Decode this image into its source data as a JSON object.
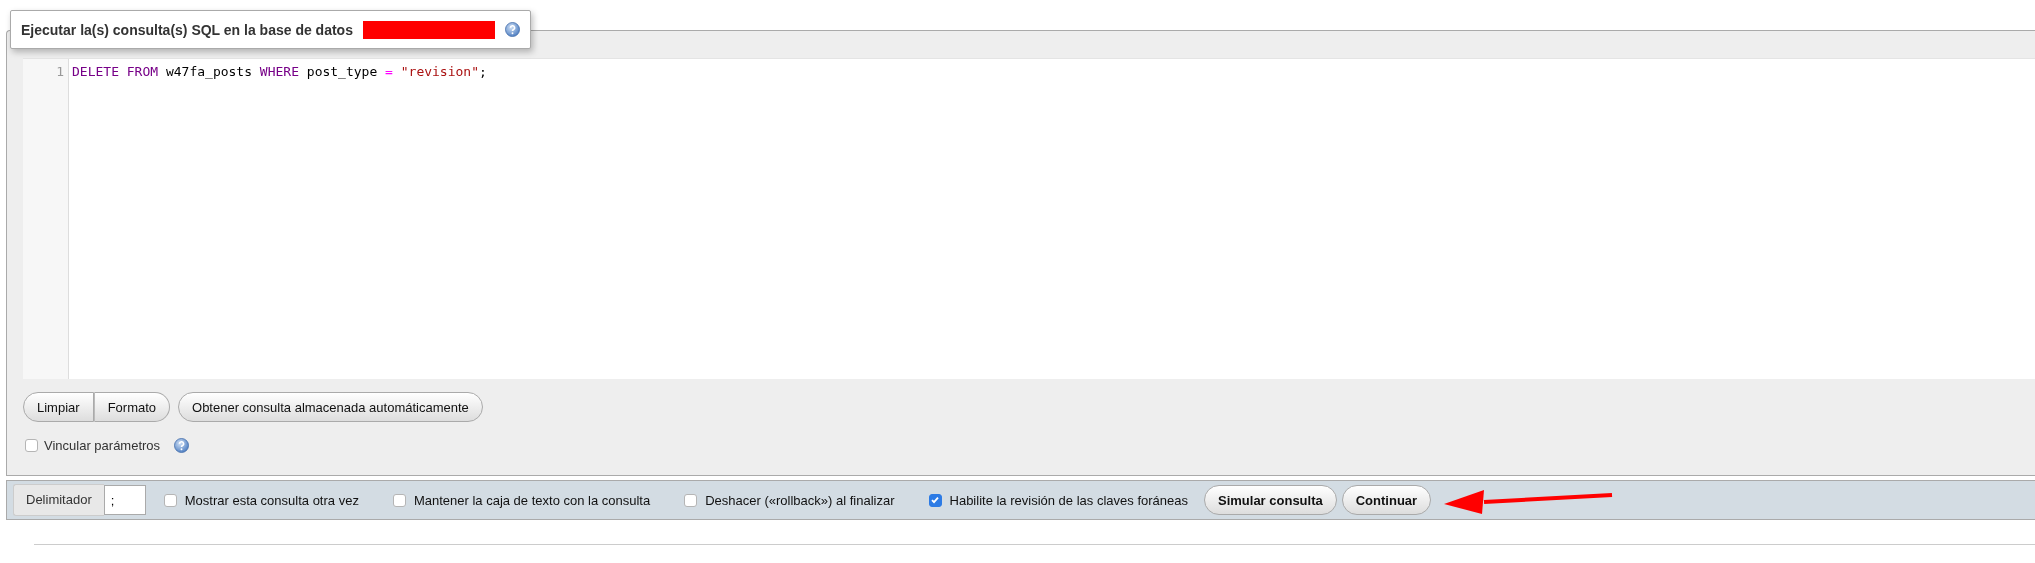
{
  "panel": {
    "title": "Ejecutar la(s) consulta(s) SQL en la base de datos",
    "redacted": true,
    "help": true
  },
  "editor": {
    "lines": [
      {
        "number": "1",
        "tokens": [
          {
            "kind": "keyword",
            "text": "DELETE FROM"
          },
          {
            "kind": "plain",
            "text": " w47fa_posts "
          },
          {
            "kind": "keyword",
            "text": "WHERE"
          },
          {
            "kind": "plain",
            "text": " post_type "
          },
          {
            "kind": "operator",
            "text": "= "
          },
          {
            "kind": "string",
            "text": "\"revision\""
          },
          {
            "kind": "plain",
            "text": ";"
          }
        ]
      }
    ]
  },
  "editor_buttons": [
    {
      "label": "Limpiar",
      "kind": "segmentstart"
    },
    {
      "label": "Formato",
      "kind": "segmentend"
    },
    {
      "label": "Obtener consulta almacenada automáticamente",
      "kind": "pill"
    }
  ],
  "bind_parameters": {
    "label": "Vincular parámetros",
    "checked": false
  },
  "footer": {
    "delimiter_label": "Delimitador",
    "delimiter_value": ";",
    "options": [
      {
        "label": "Mostrar esta consulta otra vez",
        "checked": false
      },
      {
        "label": "Mantener la caja de texto con la consulta",
        "checked": false
      },
      {
        "label": "Deshacer («rollback») al finalizar",
        "checked": false
      },
      {
        "label": "Habilite la revisión de las claves foráneas",
        "checked": true
      }
    ],
    "buttons": [
      {
        "label": "Simular consulta"
      },
      {
        "label": "Continuar"
      }
    ],
    "annotation_arrow": true
  }
}
